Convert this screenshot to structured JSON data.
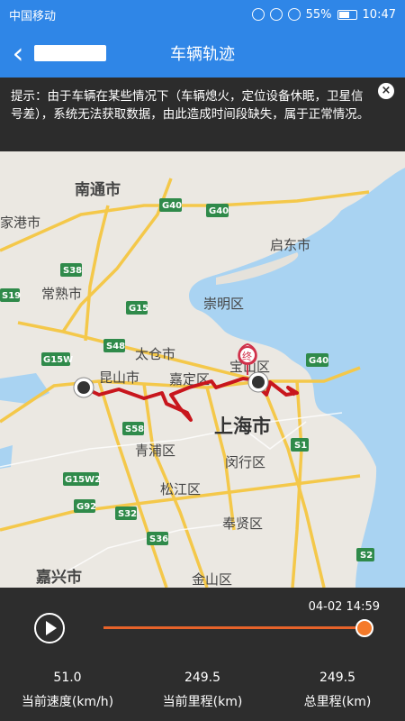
{
  "status_bar": {
    "carrier": "中国移动",
    "battery": "55%",
    "time": "10:47"
  },
  "app_bar": {
    "title": "车辆轨迹",
    "back_icon": "chevron-left-icon"
  },
  "notice": {
    "text": "提示：由于车辆在某些情况下（车辆熄火，定位设备休眠，卫星信号差），系统无法获取数据，由此造成时间段缺失，属于正常情况。",
    "close_icon": "close-icon"
  },
  "map": {
    "cities": {
      "nantong": "南通市",
      "zhangjiagang": "家港市",
      "changshu": "常熟市",
      "qidong": "启东市",
      "chongming": "崇明区",
      "taicang": "太仓市",
      "kunshan": "昆山市",
      "jiading": "嘉定区",
      "baoshan": "宝山区",
      "shanghai": "上海市",
      "qingpu": "青浦区",
      "minhang": "闵行区",
      "songjiang": "松江区",
      "fengxian": "奉贤区",
      "jinshan": "金山区",
      "jiaxing": "嘉兴市"
    },
    "roads": {
      "g40a": "G40",
      "g40b": "G40",
      "g40c": "G40",
      "s38": "S38",
      "s19": "S19",
      "g15": "G15",
      "s48": "S48",
      "g15w": "G15W",
      "s58": "S58",
      "g15w2": "G15W2",
      "g92": "G92",
      "s32": "S32",
      "s36": "S36",
      "s1": "S1",
      "s2": "S2"
    },
    "end_marker": "终",
    "route_color": "#c8161d"
  },
  "player": {
    "time": "04-02 14:59",
    "progress": 1.0,
    "accent": "#f57a2a",
    "stats": [
      {
        "value": "51.0",
        "label": "当前速度(km/h)"
      },
      {
        "value": "249.5",
        "label": "当前里程(km)"
      },
      {
        "value": "249.5",
        "label": "总里程(km)"
      }
    ]
  }
}
